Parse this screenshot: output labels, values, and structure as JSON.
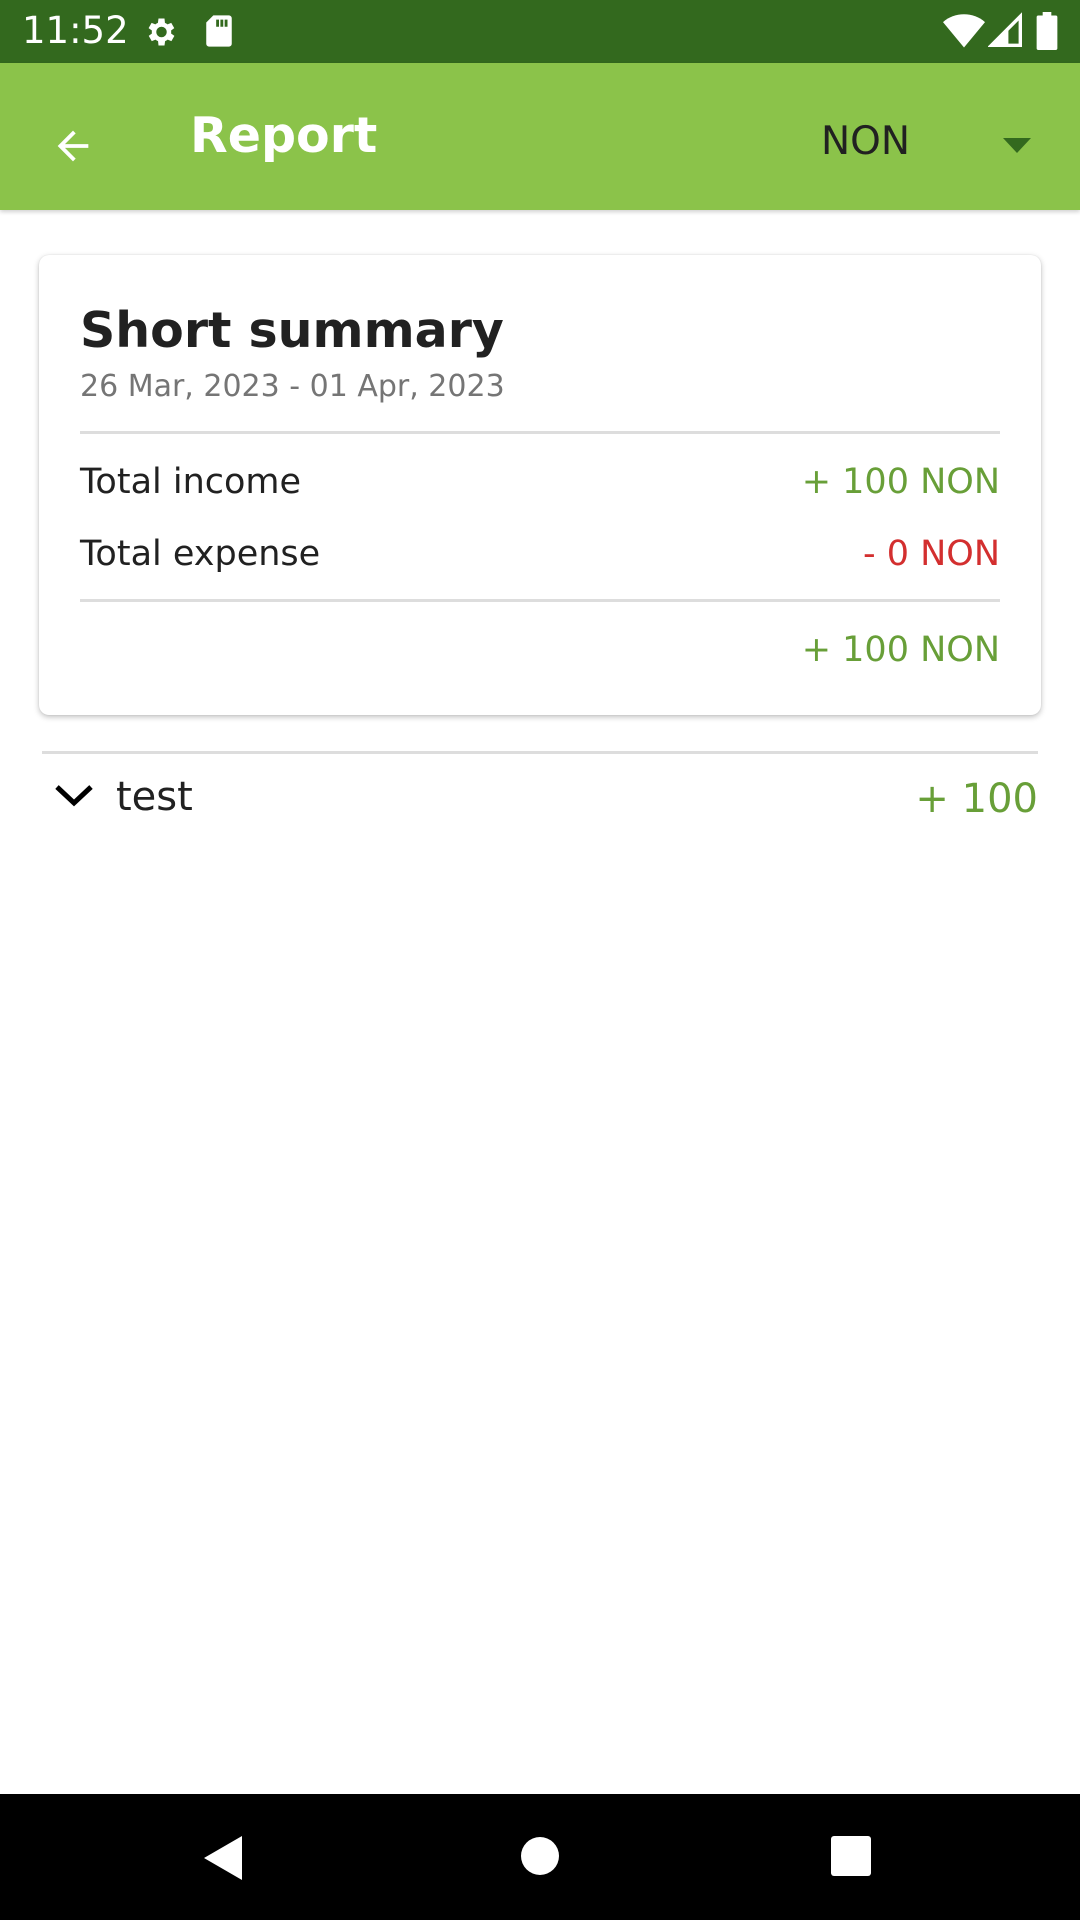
{
  "status_bar": {
    "time": "11:52",
    "icons": [
      "gear-icon",
      "sd-card-icon",
      "wifi-icon",
      "signal-icon",
      "battery-icon"
    ]
  },
  "app_bar": {
    "title": "Report",
    "currency": "NON",
    "icons": [
      "back-arrow-icon",
      "dropdown-arrow-icon"
    ]
  },
  "summary": {
    "title": "Short summary",
    "date_range": "26 Mar, 2023 - 01 Apr, 2023",
    "income_label": "Total income",
    "income_value": "+ 100 NON",
    "expense_label": "Total expense",
    "expense_value": "- 0 NON",
    "total_value": "+ 100 NON"
  },
  "groups": [
    {
      "name": "test",
      "amount": "+ 100",
      "icon": "chevron-down-icon"
    }
  ],
  "colors": {
    "status_bar": "#33691e",
    "app_bar": "#8bc34a",
    "income": "#689f38",
    "expense": "#d32f2f"
  },
  "nav_bar": {
    "icons": [
      "back-triangle-icon",
      "home-circle-icon",
      "recents-square-icon"
    ]
  }
}
